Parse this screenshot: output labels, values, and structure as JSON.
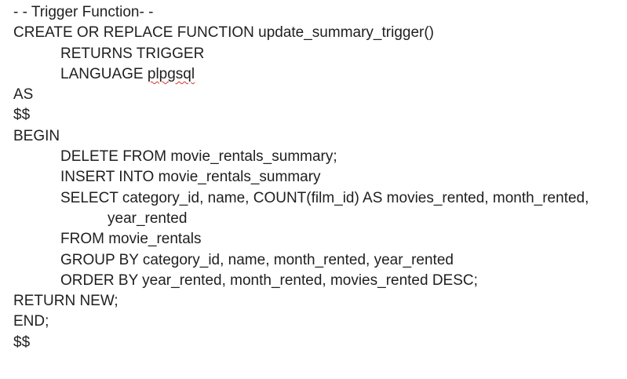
{
  "document": {
    "lines": [
      {
        "text": "- - Trigger Function- -"
      },
      {
        "text": "CREATE OR REPLACE FUNCTION update_summary_trigger()"
      },
      {
        "text": "RETURNS TRIGGER"
      },
      {
        "prefix": "LANGUAGE ",
        "misspelled": "plpgsql"
      },
      {
        "text": "AS"
      },
      {
        "text": "$$"
      },
      {
        "text": "BEGIN"
      },
      {
        "text": "DELETE FROM movie_rentals_summary;"
      },
      {
        "text": "INSERT INTO movie_rentals_summary"
      },
      {
        "text": "SELECT category_id, name, COUNT(film_id) AS movies_rented, month_rented,"
      },
      {
        "text": "year_rented"
      },
      {
        "text": "FROM movie_rentals"
      },
      {
        "text": "GROUP BY category_id, name, month_rented, year_rented"
      },
      {
        "text": "ORDER BY year_rented, month_rented, movies_rented DESC;"
      },
      {
        "text": "RETURN NEW;"
      },
      {
        "text": "END;"
      },
      {
        "text": "$$"
      }
    ]
  }
}
